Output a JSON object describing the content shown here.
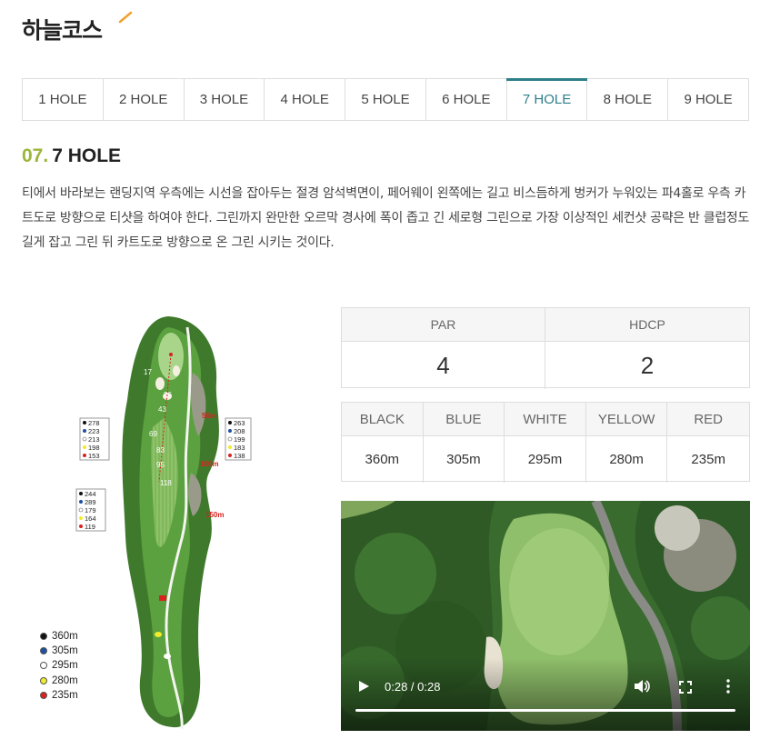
{
  "course": {
    "title": "하늘코스",
    "accent_color": "#f0a12b"
  },
  "tabs": [
    {
      "label": "1 HOLE"
    },
    {
      "label": "2 HOLE"
    },
    {
      "label": "3 HOLE"
    },
    {
      "label": "4 HOLE"
    },
    {
      "label": "5 HOLE"
    },
    {
      "label": "6 HOLE"
    },
    {
      "label": "7 HOLE",
      "active": true
    },
    {
      "label": "8 HOLE"
    },
    {
      "label": "9 HOLE"
    }
  ],
  "active_color": "#2d7f8a",
  "hole": {
    "number": "07.",
    "name": "7 HOLE",
    "description": "티에서 바라보는 랜딩지역 우측에는 시선을 잡아두는 절경 암석벽면이, 페어웨이 왼쪽에는 길고 비스듬하게 벙커가 누워있는 파4홀로 우측 카트도로 방향으로 티샷을 하여야 한다. 그린까지 완만한 오르막 경사에 폭이 좁고 긴 세로형 그린으로 가장 이상적인 세컨샷 공략은 반 클럽정도 길게 잡고 그린 뒤 카트도로 방향으로 온 그린 시키는 것이다."
  },
  "map": {
    "pin_markers": [
      "17",
      "26",
      "43",
      "69",
      "83",
      "95",
      "118"
    ],
    "left_box_1": [
      "278",
      "223",
      "213",
      "198",
      "153"
    ],
    "left_box_2": [
      "244",
      "289",
      "179",
      "164",
      "119"
    ],
    "right_box": [
      "263",
      "208",
      "199",
      "183",
      "138"
    ],
    "distance_labels": [
      "50m",
      "100m",
      "150m"
    ]
  },
  "legend": [
    {
      "label": "360m",
      "color": "#111111"
    },
    {
      "label": "305m",
      "color": "#1f4fa0"
    },
    {
      "label": "295m",
      "color": "#ffffff"
    },
    {
      "label": "280m",
      "color": "#f1ec2a"
    },
    {
      "label": "235m",
      "color": "#d8221f"
    }
  ],
  "stats": {
    "par_label": "PAR",
    "par_value": "4",
    "hdcp_label": "HDCP",
    "hdcp_value": "2"
  },
  "tees": [
    {
      "label": "BLACK",
      "distance": "360m"
    },
    {
      "label": "BLUE",
      "distance": "305m"
    },
    {
      "label": "WHITE",
      "distance": "295m"
    },
    {
      "label": "YELLOW",
      "distance": "280m"
    },
    {
      "label": "RED",
      "distance": "235m"
    }
  ],
  "video": {
    "time": "0:28 / 0:28",
    "progress": 1.0
  }
}
